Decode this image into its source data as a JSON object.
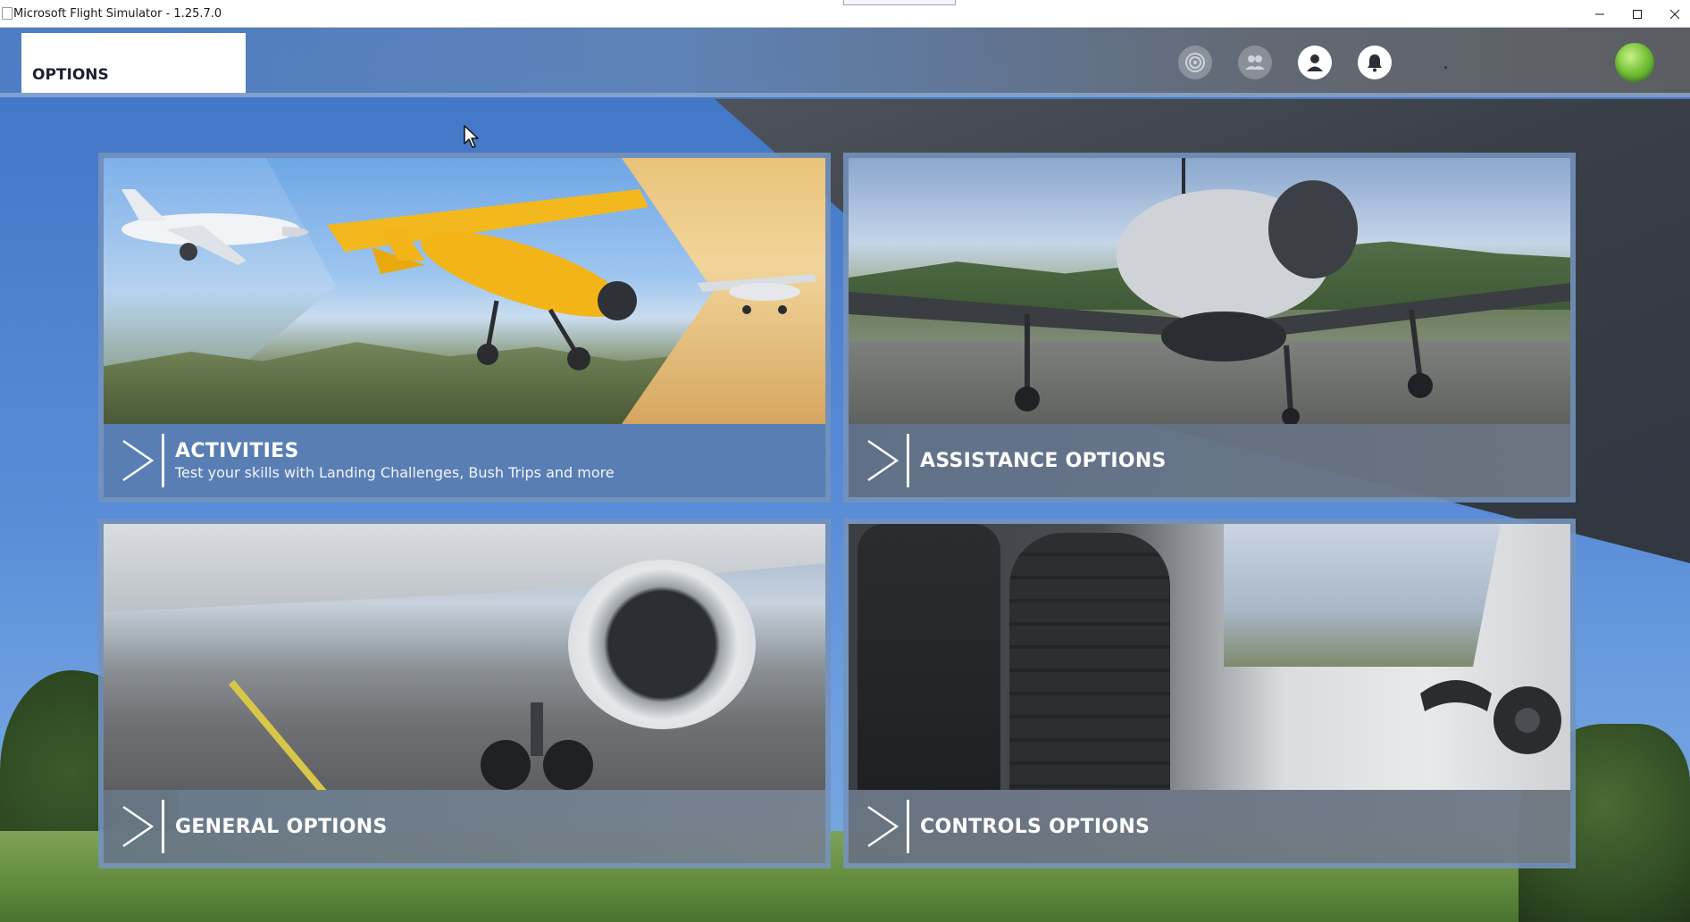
{
  "window": {
    "title": "Microsoft Flight Simulator - 1.25.7.0"
  },
  "header": {
    "page_tab": "OPTIONS",
    "icons": [
      "activity-icon",
      "friends-icon",
      "profile-icon",
      "notifications-icon",
      "status-orb"
    ]
  },
  "tiles": [
    {
      "id": "activities",
      "title": "ACTIVITIES",
      "subtitle": "Test your skills with Landing Challenges, Bush Trips and more"
    },
    {
      "id": "assistance",
      "title": "ASSISTANCE OPTIONS"
    },
    {
      "id": "general",
      "title": "GENERAL OPTIONS"
    },
    {
      "id": "controls",
      "title": "CONTROLS OPTIONS"
    }
  ],
  "colors": {
    "accent_blue": "#4f7ec4",
    "tile_border": "#7896be",
    "status_green": "#79c53a",
    "text_white": "#ffffff"
  }
}
